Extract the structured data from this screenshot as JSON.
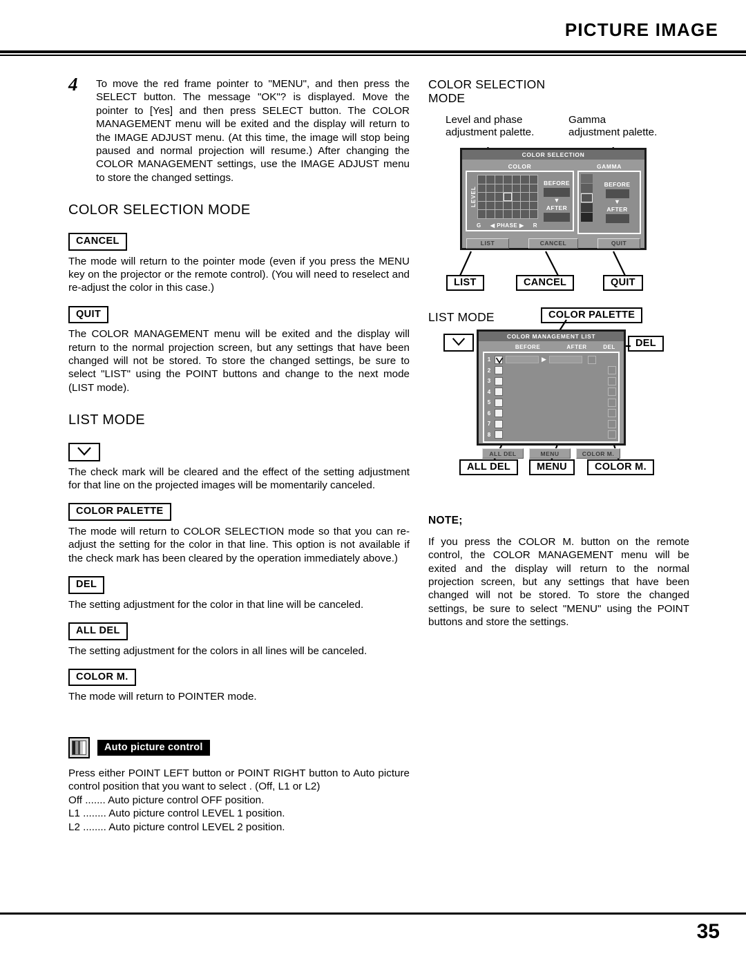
{
  "header": {
    "title": "PICTURE IMAGE"
  },
  "footer": {
    "page_number": "35"
  },
  "step": {
    "number": "4",
    "text": "To move the red frame pointer to \"MENU\", and then press the SELECT button. The message \"OK\"? is displayed. Move the pointer to [Yes] and then press SELECT button. The COLOR MANAGEMENT menu will be exited and the display will return to the IMAGE ADJUST menu. (At this time, the image will stop being paused and normal projection will resume.) After changing the COLOR MANAGEMENT settings, use the IMAGE ADJUST menu to store the changed settings."
  },
  "left": {
    "color_selection_heading": "COLOR SELECTION MODE",
    "cancel": {
      "chip": "CANCEL",
      "text": "The mode will return to the pointer mode (even if you press the MENU key on the projector or the remote control). (You will need to reselect and re-adjust the color in this case.)"
    },
    "quit": {
      "chip": "QUIT",
      "text": "The COLOR MANAGEMENT menu will be exited and the display will return to the normal projection screen, but any settings that have been changed will not be stored. To store the changed settings, be sure to select \"LIST\" using the POINT buttons and change to the next mode (LIST mode)."
    },
    "list_mode_heading": "LIST MODE",
    "checkmark": {
      "chip_icon": "checkmark-icon",
      "text": "The check mark will be cleared and the effect of the setting adjustment for that line on the projected images will be momentarily canceled."
    },
    "color_palette": {
      "chip": "COLOR PALETTE",
      "text": "The mode will return to COLOR SELECTION mode so that you can re-adjust the setting for the color in that line. This option is not available if the check mark has been cleared by the operation immediately above.)"
    },
    "del": {
      "chip": "DEL",
      "text": "The setting adjustment for the color in that line will be canceled."
    },
    "all_del": {
      "chip": "ALL DEL",
      "text": "The setting adjustment for the colors in all lines will be canceled."
    },
    "color_m": {
      "chip": "COLOR M.",
      "text": "The mode will return to POINTER mode."
    },
    "auto_picture_control": {
      "icon": "picture-bars-icon",
      "title": "Auto picture control",
      "intro": "Press either POINT LEFT button or POINT RIGHT button to Auto picture control position that you want to select . (Off, L1 or L2)",
      "options": [
        "Off ....... Auto picture control OFF position.",
        "L1 ........ Auto picture control LEVEL 1 position.",
        "L2 ........ Auto picture control LEVEL 2 position."
      ]
    }
  },
  "right": {
    "cs_mode_heading_line1": "COLOR SELECTION",
    "cs_mode_heading_line2": "MODE",
    "callout_left_line1": "Level and phase",
    "callout_left_line2": "adjustment palette.",
    "callout_right_line1": "Gamma",
    "callout_right_line2": "adjustment palette.",
    "color_selection_osd": {
      "title": "COLOR SELECTION",
      "color_panel_label": "COLOR",
      "gamma_panel_label": "GAMMA",
      "level_label": "LEVEL",
      "phase_label": "PHASE",
      "phase_left": "G",
      "phase_right": "R",
      "before_label": "BEFORE",
      "after_label": "AFTER",
      "grid_cols": 7,
      "grid_rows": 5,
      "selected_cell": {
        "row": 3,
        "col": 4
      },
      "gamma_cells": [
        "#6a6a6a",
        "#5e5e5e",
        "#545454",
        "#3c3c3c",
        "#262626"
      ],
      "gamma_selected_index": 3,
      "buttons": [
        "LIST",
        "CANCEL",
        "QUIT"
      ]
    },
    "cs_button_labels": [
      "LIST",
      "CANCEL",
      "QUIT"
    ],
    "list_mode_heading": "LIST MODE",
    "list_mode_labels": {
      "color_palette": "COLOR PALETTE",
      "del": "DEL",
      "checkmark_icon": "checkmark-icon"
    },
    "color_management_list": {
      "title": "COLOR MANAGEMENT LIST",
      "columns": [
        "BEFORE",
        "AFTER",
        "DEL"
      ],
      "rows": [
        "1",
        "2",
        "3",
        "4",
        "5",
        "6",
        "7",
        "8"
      ],
      "checked_rows": [
        "1"
      ],
      "buttons": [
        "ALL DEL",
        "MENU",
        "COLOR M."
      ]
    },
    "cml_button_labels": [
      "ALL DEL",
      "MENU",
      "COLOR M."
    ],
    "note": {
      "heading": "NOTE;",
      "text": "If you press the COLOR M. button on the remote control, the COLOR MANAGEMENT menu will be exited and the display will return to the normal projection screen, but any settings that have been changed will not be stored. To store the changed settings, be sure to select \"MENU\" using the POINT buttons and store the settings."
    }
  }
}
